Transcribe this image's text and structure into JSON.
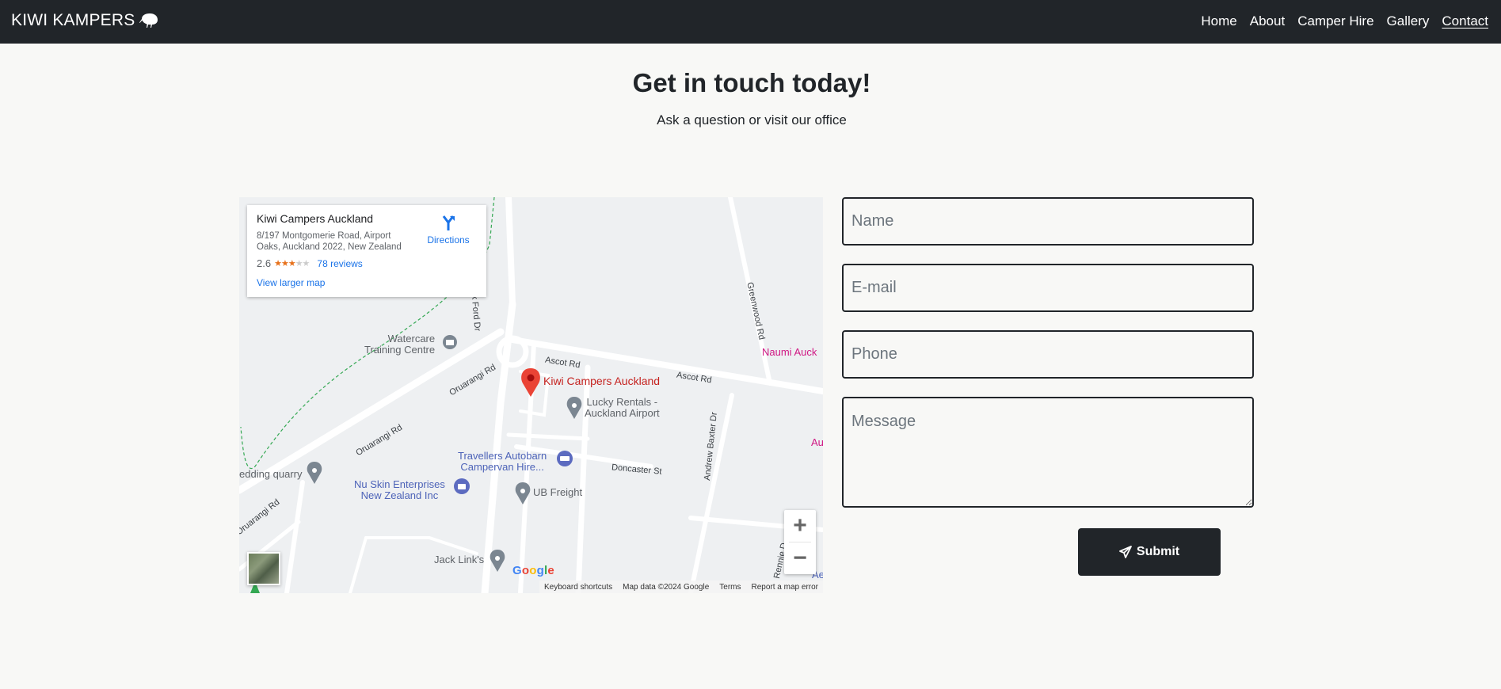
{
  "nav": {
    "brand": "KIWI KAMPERS",
    "links": [
      {
        "label": "Home",
        "active": false
      },
      {
        "label": "About",
        "active": false
      },
      {
        "label": "Camper Hire",
        "active": false
      },
      {
        "label": "Gallery",
        "active": false
      },
      {
        "label": "Contact",
        "active": true
      }
    ]
  },
  "header": {
    "title": "Get in touch today!",
    "subtitle": "Ask a question or visit our office"
  },
  "map": {
    "card": {
      "name": "Kiwi Campers Auckland",
      "address": "8/197 Montgomerie Road, Airport Oaks, Auckland 2022, New Zealand",
      "rating": "2.6",
      "stars_filled": 2.5,
      "reviews": "78 reviews",
      "directions": "Directions",
      "larger_map": "View larger map"
    },
    "labels": {
      "watercare": "Watercare\nTraining Centre",
      "mark_ford": "Mark Ford Dr",
      "greenwood": "Greenwood Rd",
      "ascot1": "Ascot Rd",
      "ascot2": "Ascot Rd",
      "oruarangi1": "Oruarangi Rd",
      "oruarangi2": "Oruarangi Rd",
      "oruarangi3": "Oruarangi Rd",
      "kiwi_pin": "Kiwi Campers Auckland",
      "naumi": "Naumi Auck",
      "au": "Au",
      "lucky": "Lucky Rentals -\nAuckland Airport",
      "andrew_baxter": "Andrew Baxter Dr",
      "travellers": "Travellers Autobarn\nCampervan Hire...",
      "doncaster": "Doncaster St",
      "nuskin": "Nu Skin Enterprises\nNew Zealand Inc",
      "ub_freight": "UB Freight",
      "quarry": "edding quarry",
      "jack_links": "Jack Link's",
      "rennie": "Rennie D",
      "ae": "Ae"
    },
    "zoom_in": "+",
    "zoom_out": "−",
    "google": "Google",
    "footer": {
      "shortcuts": "Keyboard shortcuts",
      "data": "Map data ©2024 Google",
      "terms": "Terms",
      "report": "Report a map error"
    }
  },
  "form": {
    "name_placeholder": "Name",
    "email_placeholder": "E-mail",
    "phone_placeholder": "Phone",
    "message_placeholder": "Message",
    "submit_label": "Submit"
  }
}
